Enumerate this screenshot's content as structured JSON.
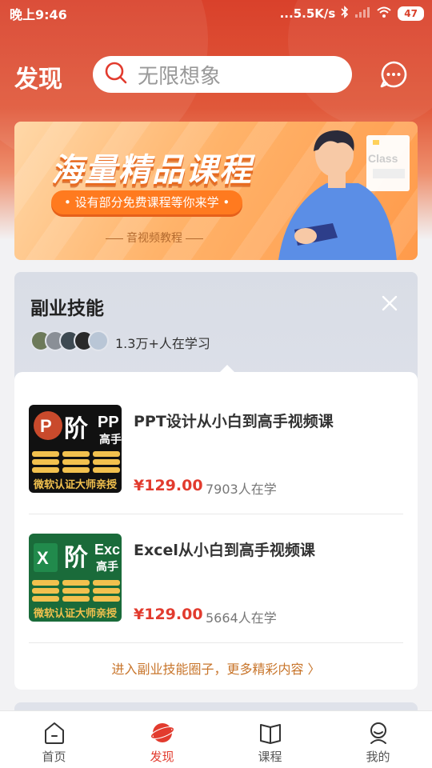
{
  "status_bar": {
    "time": "晚上9:46",
    "network_speed": "...5.5K/s",
    "battery": "47"
  },
  "header": {
    "title": "发现",
    "search_placeholder": "无限想象"
  },
  "banner": {
    "title": "海量精品课程",
    "pill_text": "• 设有部分免费课程等你来学 •",
    "subtitle": "音视频教程",
    "card_text": "Class"
  },
  "skill_section": {
    "title": "副业技能",
    "learners": "1.3万+人在学习",
    "courses": [
      {
        "name": "PPT设计从小白到高手视频课",
        "price": "¥129.00",
        "students": "7903人在学",
        "thumb_badge": "P",
        "thumb_big": "阶",
        "thumb_side": "PP",
        "thumb_side2": "高手",
        "thumb_footer": "微软认证大师亲授",
        "thumb_color": "#c94a2c"
      },
      {
        "name": "Excel从小白到高手视频课",
        "price": "¥129.00",
        "students": "5664人在学",
        "thumb_badge": "X",
        "thumb_big": "阶",
        "thumb_side": "Exc",
        "thumb_side2": "高手",
        "thumb_footer": "微软认证大师亲授",
        "thumb_color": "#1f7a45"
      }
    ],
    "more_link": "进入副业技能圈子，更多精彩内容 〉"
  },
  "bottom_nav": {
    "items": [
      {
        "label": "首页",
        "icon": "home-icon"
      },
      {
        "label": "发现",
        "icon": "discover-icon"
      },
      {
        "label": "课程",
        "icon": "book-icon"
      },
      {
        "label": "我的",
        "icon": "profile-icon"
      }
    ],
    "active_index": 1
  },
  "colors": {
    "accent": "#e23b2e",
    "header_bg": "#d9412b",
    "link": "#c8752b"
  }
}
